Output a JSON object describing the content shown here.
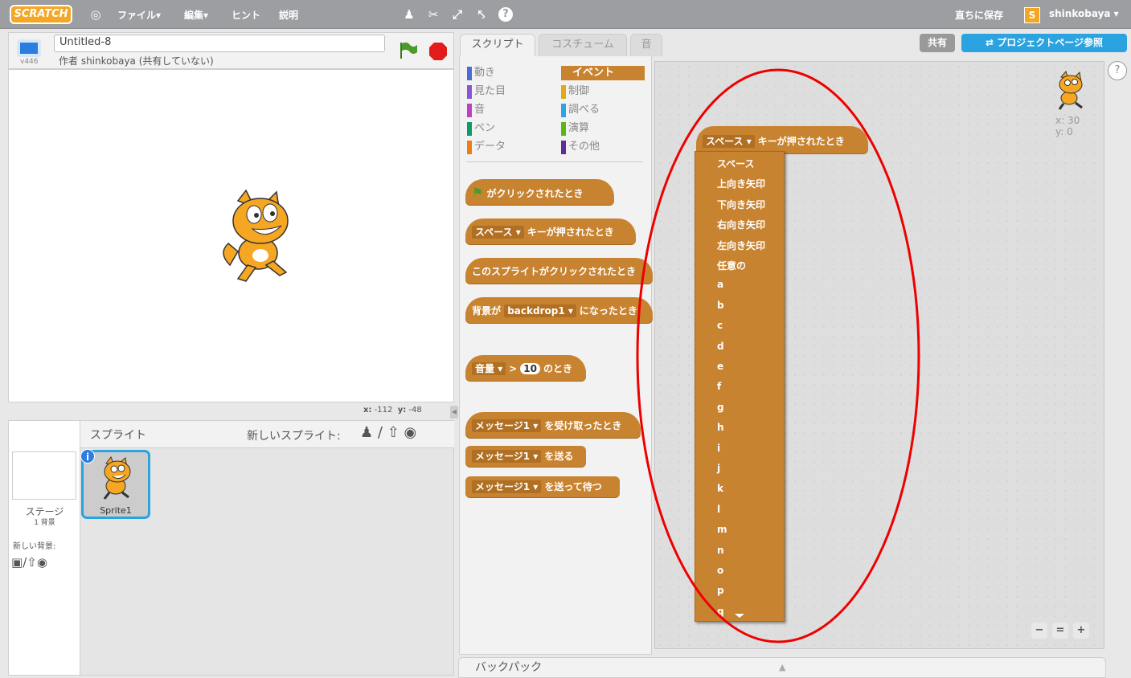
{
  "menubar": {
    "logo": "SCRATCH",
    "file": "ファイル▾",
    "edit": "編集▾",
    "tips": "ヒント",
    "about": "説明",
    "save_now": "直ちに保存",
    "username": "shinkobaya ▾",
    "user_icon_label": "S"
  },
  "stage_header": {
    "version": "v446",
    "project_title": "Untitled-8",
    "author": "作者 shinkobaya (共有していない)"
  },
  "stage": {
    "x_label": "x:",
    "x_value": "-112",
    "y_label": "y:",
    "y_value": "-48"
  },
  "sprites": {
    "header": "スプライト",
    "new_sprite": "新しいスプライト:",
    "stage_label": "ステージ",
    "backdrop_count": "1 背景",
    "new_backdrop": "新しい背景:",
    "sprite1_name": "Sprite1"
  },
  "tabs": {
    "scripts": "スクリプト",
    "costumes": "コスチューム",
    "sounds": "音"
  },
  "share": {
    "share_label": "共有",
    "project_page": "プロジェクトページ参照"
  },
  "categories": {
    "motion": "動き",
    "looks": "見た目",
    "sound": "音",
    "pen": "ペン",
    "data": "データ",
    "events": "イベント",
    "control": "制御",
    "sensing": "調べる",
    "operators": "演算",
    "more": "その他"
  },
  "colors": {
    "motion": "#4a6cd4",
    "looks": "#8a55d7",
    "sound": "#bb42c3",
    "pen": "#0e9a6c",
    "data": "#ee7d16",
    "events": "#c88330",
    "control": "#e1a91a",
    "sensing": "#2ca5e2",
    "operators": "#5cb712",
    "more": "#632d99"
  },
  "blocks": {
    "flag_clicked": "がクリックされたとき",
    "key_dd": "スペース",
    "key_pressed": "キーが押されたとき",
    "sprite_clicked": "このスプライトがクリックされたとき",
    "backdrop_prefix": "背景が",
    "backdrop_dd": "backdrop1",
    "backdrop_suffix": "になったとき",
    "loudness_dd": "音量",
    "gt": ">",
    "loud_value": "10",
    "loud_suffix": "のとき",
    "msg_dd": "メッセージ1",
    "receive": "を受け取ったとき",
    "broadcast": "を送る",
    "broadcast_wait": "を送って待つ"
  },
  "script_block": {
    "dd": "スペース",
    "label": "キーが押されたとき"
  },
  "key_menu": [
    "スペース",
    "上向き矢印",
    "下向き矢印",
    "右向き矢印",
    "左向き矢印",
    "任意の",
    "a",
    "b",
    "c",
    "d",
    "e",
    "f",
    "g",
    "h",
    "i",
    "j",
    "k",
    "l",
    "m",
    "n",
    "o",
    "p",
    "q"
  ],
  "script_area": {
    "x_label": "x: 30",
    "y_label": "y: 0",
    "help": "?"
  },
  "backpack": {
    "label": "バックパック"
  }
}
